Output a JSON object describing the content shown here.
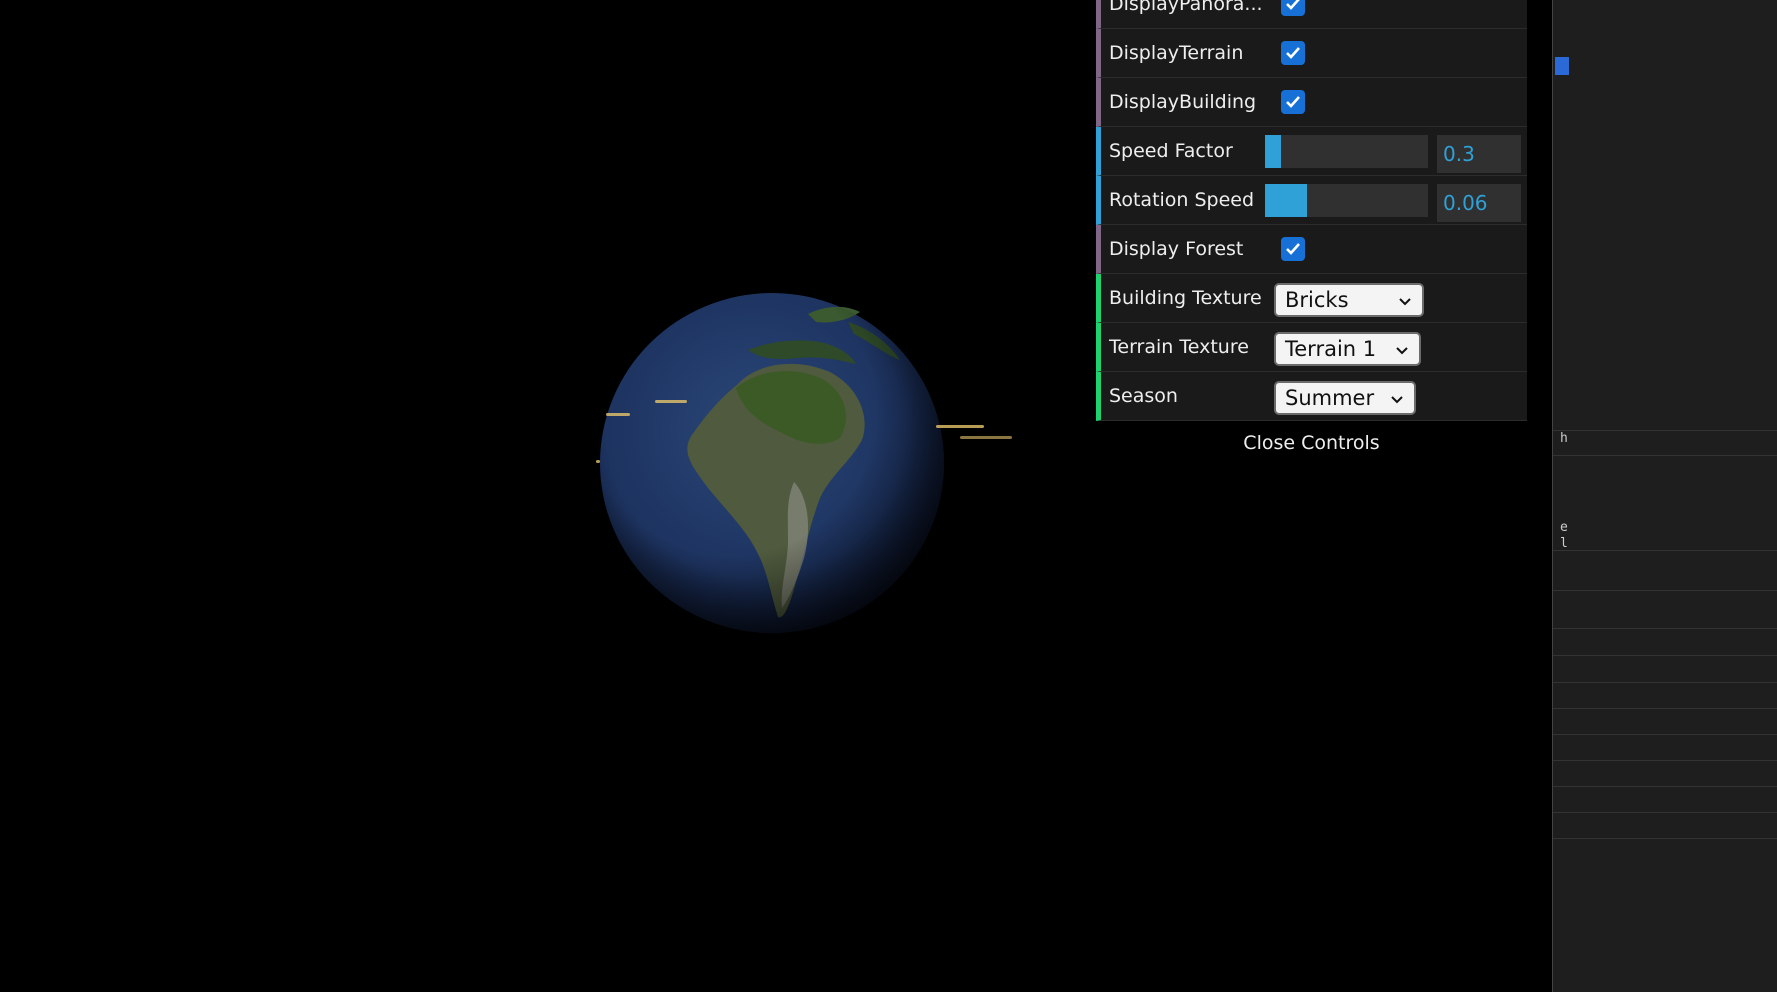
{
  "controls": {
    "display_panorama": {
      "label": "DisplayPanora...",
      "checked": true
    },
    "display_terrain": {
      "label": "DisplayTerrain",
      "checked": true
    },
    "display_building": {
      "label": "DisplayBuilding",
      "checked": true
    },
    "speed_factor": {
      "label": "Speed Factor",
      "value": "0.3",
      "level": 0.1
    },
    "rotation_speed": {
      "label": "Rotation Speed",
      "value": "0.06",
      "level": 0.26
    },
    "display_forest": {
      "label": "Display Forest",
      "checked": true
    },
    "building_texture": {
      "label": "Building Texture",
      "selected": "Bricks"
    },
    "terrain_texture": {
      "label": "Terrain Texture",
      "selected": "Terrain 1"
    },
    "season": {
      "label": "Season",
      "selected": "Summer"
    },
    "close_label": "Close Controls"
  },
  "devtools": {
    "fragments": [
      "h",
      "e",
      "l"
    ]
  },
  "colors": {
    "boolean_accent": "#806787",
    "number_accent": "#2fa1d6",
    "option_accent": "#1ed36f",
    "checkbox": "#1670d6"
  },
  "icons": [
    "checkmark-icon",
    "chevron-down-icon",
    "earth-globe"
  ]
}
